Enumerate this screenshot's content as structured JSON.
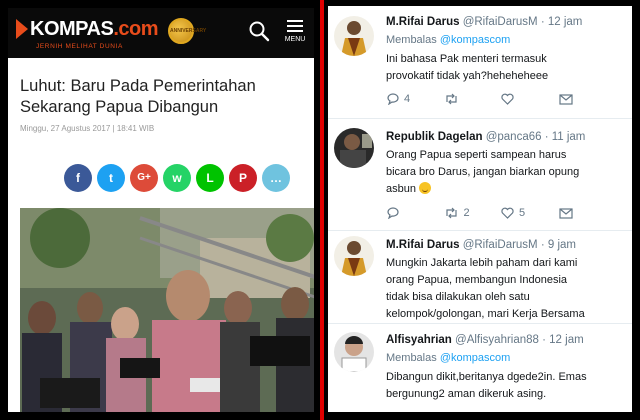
{
  "kompas": {
    "logo_text": "KOMPAS",
    "logo_suffix": ".com",
    "tagline": "JERNIH MELIHAT DUNIA",
    "badge_text": "ANNIVERSARY",
    "menu_label": "MENU",
    "article_title": "Luhut: Baru Pada Pemerintahan Sekarang Papua Dibangun",
    "article_date": "Minggu, 27 Agustus 2017 | 18:41 WIB",
    "share_buttons": [
      {
        "name": "facebook",
        "glyph": "f",
        "color": "#3b5998"
      },
      {
        "name": "twitter",
        "glyph": "t",
        "color": "#1da1f2"
      },
      {
        "name": "google-plus",
        "glyph": "G+",
        "color": "#dd4b39"
      },
      {
        "name": "whatsapp",
        "glyph": "w",
        "color": "#25d366"
      },
      {
        "name": "line",
        "glyph": "L",
        "color": "#00c300"
      },
      {
        "name": "pinterest",
        "glyph": "P",
        "color": "#cb2027"
      },
      {
        "name": "comment",
        "glyph": "…",
        "color": "#6fc3df"
      }
    ]
  },
  "tweets": [
    {
      "name": "M.Rifai Darus",
      "handle": "@RifaiDarusM · 12 jam",
      "reply_prefix": "Membalas",
      "reply_to": "@kompascom",
      "lines": [
        "Ini bahasa Pak menteri termasuk",
        "provokatif tidak yah?heheheheee"
      ],
      "replies": "4",
      "retweets": "",
      "likes": "",
      "avatar": "rifai"
    },
    {
      "name": "Republik Dagelan",
      "handle": "@panca66 · 11 jam",
      "reply_prefix": "",
      "reply_to": "",
      "lines": [
        "Orang Papua seperti sampean harus",
        "bicara bro Darus, jangan biarkan opung",
        "asbun"
      ],
      "replies": "",
      "retweets": "2",
      "likes": "5",
      "avatar": "dagelan"
    },
    {
      "name": "M.Rifai Darus",
      "handle": "@RifaiDarusM · 9 jam",
      "reply_prefix": "",
      "reply_to": "",
      "lines": [
        "Mungkin Jakarta lebih paham dari kami",
        "orang Papua, membangun Indonesia",
        "tidak bisa dilakukan oleh satu",
        "kelompok/golongan, mari Kerja Bersama"
      ],
      "replies": "",
      "retweets": "",
      "likes": "",
      "avatar": "rifai"
    },
    {
      "name": "Alfisyahrian",
      "handle": "@Alfisyahrian88 · 12 jam",
      "reply_prefix": "Membalas",
      "reply_to": "@kompascom",
      "lines": [
        "Dibangun dikit,beritanya dgede2in. Emas",
        "bergunung2 aman dikeruk asing."
      ],
      "replies": "",
      "retweets": "",
      "likes": "",
      "avatar": "alfi"
    }
  ],
  "colors": {
    "divider": "#e00000",
    "kompas_header": "#0a0a0a",
    "kompas_accent": "#e84c1b",
    "twitter_blue": "#1da1f2",
    "twitter_gray": "#657786"
  }
}
